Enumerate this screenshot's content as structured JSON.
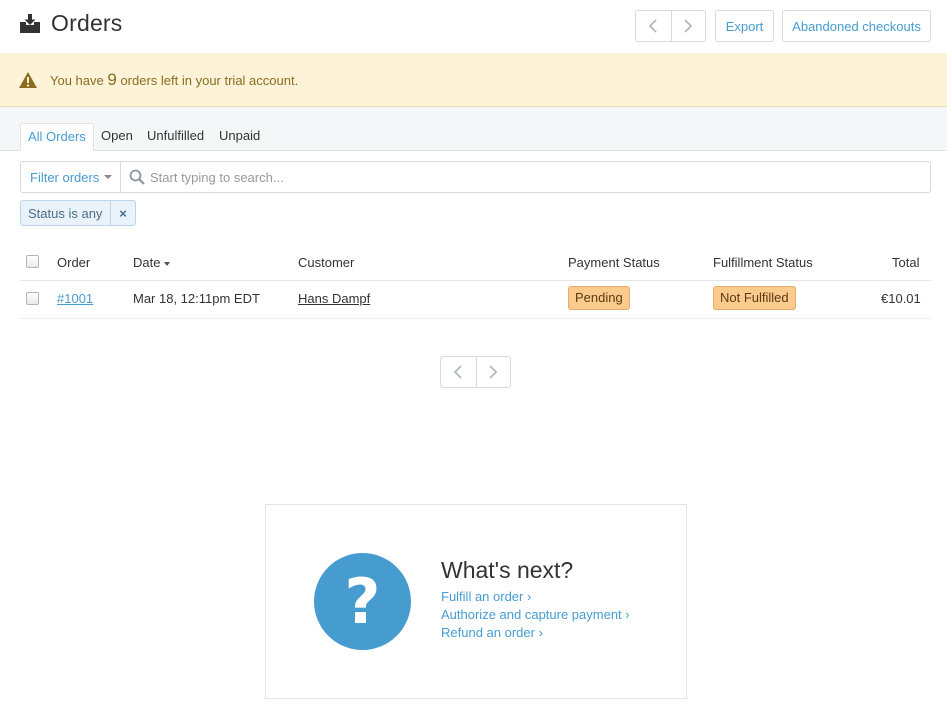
{
  "header": {
    "title": "Orders",
    "icon": "inbox-download-icon",
    "export_label": "Export",
    "abandoned_label": "Abandoned checkouts"
  },
  "banner": {
    "prefix": "You have ",
    "count": "9",
    "suffix": " orders left in your trial account."
  },
  "tabs": [
    {
      "label": "All Orders",
      "active": true
    },
    {
      "label": "Open"
    },
    {
      "label": "Unfulfilled"
    },
    {
      "label": "Unpaid"
    }
  ],
  "filter": {
    "button_label": "Filter orders",
    "search_placeholder": "Start typing to search...",
    "chip_label": "Status is any",
    "chip_remove": "×"
  },
  "table": {
    "columns": [
      "Order",
      "Date",
      "Customer",
      "Payment Status",
      "Fulfillment Status",
      "Total"
    ],
    "rows": [
      {
        "order": "#1001",
        "date": "Mar 18, 12:11pm EDT",
        "customer": "Hans Dampf",
        "payment_status": "Pending",
        "fulfillment_status": "Not Fulfilled",
        "total": "€10.01"
      }
    ]
  },
  "whats_next": {
    "title": "What's next?",
    "links": [
      "Fulfill an order ›",
      "Authorize and capture payment ›",
      "Refund an order ›"
    ]
  },
  "colors": {
    "accent": "#479ccf",
    "banner_bg": "#fcf3d8",
    "badge_bg": "#fbcb8e"
  }
}
